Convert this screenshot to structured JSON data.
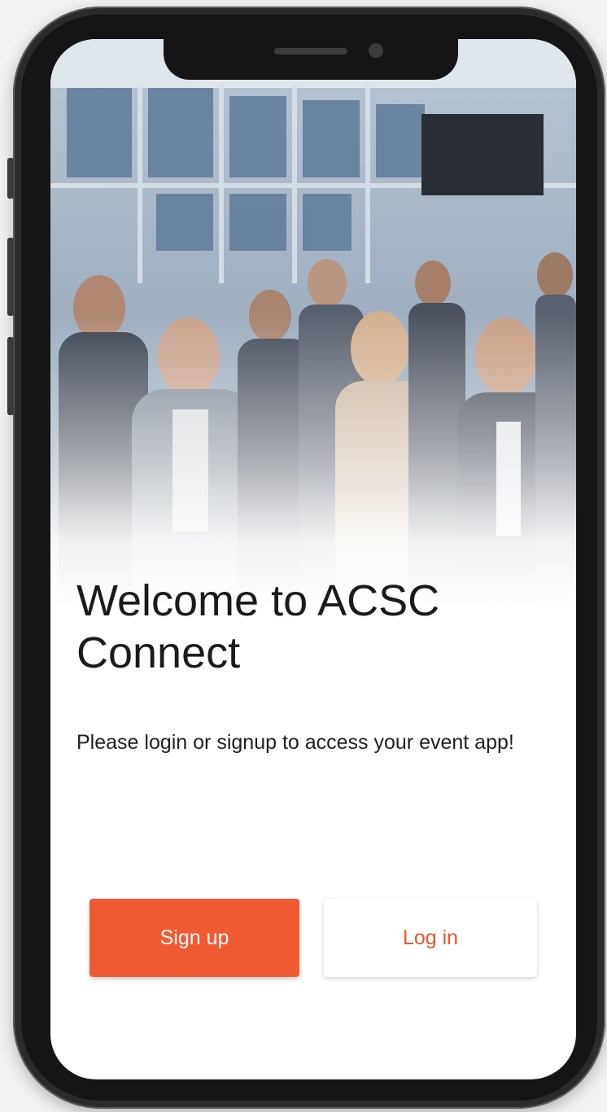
{
  "screen": {
    "title": "Welcome to ACSC Connect",
    "subtitle": "Please login or signup to access your event app!"
  },
  "actions": {
    "signup_label": "Sign up",
    "login_label": "Log in"
  },
  "colors": {
    "accent": "#f05a32",
    "accent_text": "#e8552e",
    "phone_frame": "#151515",
    "background": "#f2f2f3"
  },
  "hero": {
    "icon": "event-crowd-photo"
  }
}
